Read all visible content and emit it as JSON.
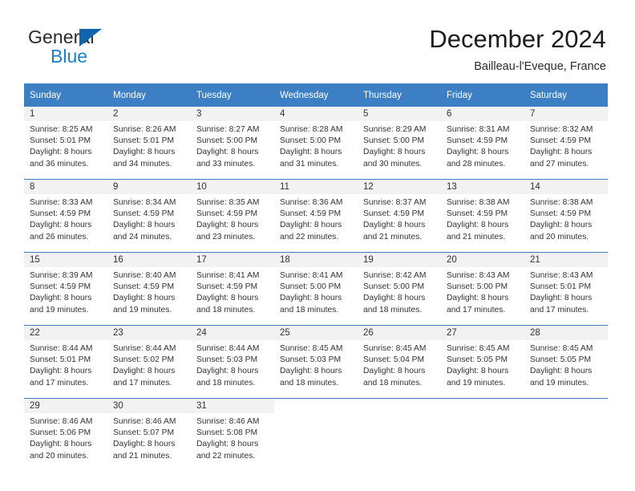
{
  "logo": {
    "word_top": "General",
    "word_bottom": "Blue",
    "triangle_color": "#1264ac",
    "blue_color": "#1b7fd4"
  },
  "header": {
    "title": "December 2024",
    "subtitle": "Bailleau-l'Eveque, France"
  },
  "colors": {
    "header_row": "#3c7fc4",
    "daynum_band": "#f2f2f2",
    "text": "#333333"
  },
  "weekday_headers": [
    "Sunday",
    "Monday",
    "Tuesday",
    "Wednesday",
    "Thursday",
    "Friday",
    "Saturday"
  ],
  "weeks": [
    [
      {
        "day": "1",
        "sunrise": "Sunrise: 8:25 AM",
        "sunset": "Sunset: 5:01 PM",
        "daylight1": "Daylight: 8 hours",
        "daylight2": "and 36 minutes."
      },
      {
        "day": "2",
        "sunrise": "Sunrise: 8:26 AM",
        "sunset": "Sunset: 5:01 PM",
        "daylight1": "Daylight: 8 hours",
        "daylight2": "and 34 minutes."
      },
      {
        "day": "3",
        "sunrise": "Sunrise: 8:27 AM",
        "sunset": "Sunset: 5:00 PM",
        "daylight1": "Daylight: 8 hours",
        "daylight2": "and 33 minutes."
      },
      {
        "day": "4",
        "sunrise": "Sunrise: 8:28 AM",
        "sunset": "Sunset: 5:00 PM",
        "daylight1": "Daylight: 8 hours",
        "daylight2": "and 31 minutes."
      },
      {
        "day": "5",
        "sunrise": "Sunrise: 8:29 AM",
        "sunset": "Sunset: 5:00 PM",
        "daylight1": "Daylight: 8 hours",
        "daylight2": "and 30 minutes."
      },
      {
        "day": "6",
        "sunrise": "Sunrise: 8:31 AM",
        "sunset": "Sunset: 4:59 PM",
        "daylight1": "Daylight: 8 hours",
        "daylight2": "and 28 minutes."
      },
      {
        "day": "7",
        "sunrise": "Sunrise: 8:32 AM",
        "sunset": "Sunset: 4:59 PM",
        "daylight1": "Daylight: 8 hours",
        "daylight2": "and 27 minutes."
      }
    ],
    [
      {
        "day": "8",
        "sunrise": "Sunrise: 8:33 AM",
        "sunset": "Sunset: 4:59 PM",
        "daylight1": "Daylight: 8 hours",
        "daylight2": "and 26 minutes."
      },
      {
        "day": "9",
        "sunrise": "Sunrise: 8:34 AM",
        "sunset": "Sunset: 4:59 PM",
        "daylight1": "Daylight: 8 hours",
        "daylight2": "and 24 minutes."
      },
      {
        "day": "10",
        "sunrise": "Sunrise: 8:35 AM",
        "sunset": "Sunset: 4:59 PM",
        "daylight1": "Daylight: 8 hours",
        "daylight2": "and 23 minutes."
      },
      {
        "day": "11",
        "sunrise": "Sunrise: 8:36 AM",
        "sunset": "Sunset: 4:59 PM",
        "daylight1": "Daylight: 8 hours",
        "daylight2": "and 22 minutes."
      },
      {
        "day": "12",
        "sunrise": "Sunrise: 8:37 AM",
        "sunset": "Sunset: 4:59 PM",
        "daylight1": "Daylight: 8 hours",
        "daylight2": "and 21 minutes."
      },
      {
        "day": "13",
        "sunrise": "Sunrise: 8:38 AM",
        "sunset": "Sunset: 4:59 PM",
        "daylight1": "Daylight: 8 hours",
        "daylight2": "and 21 minutes."
      },
      {
        "day": "14",
        "sunrise": "Sunrise: 8:38 AM",
        "sunset": "Sunset: 4:59 PM",
        "daylight1": "Daylight: 8 hours",
        "daylight2": "and 20 minutes."
      }
    ],
    [
      {
        "day": "15",
        "sunrise": "Sunrise: 8:39 AM",
        "sunset": "Sunset: 4:59 PM",
        "daylight1": "Daylight: 8 hours",
        "daylight2": "and 19 minutes."
      },
      {
        "day": "16",
        "sunrise": "Sunrise: 8:40 AM",
        "sunset": "Sunset: 4:59 PM",
        "daylight1": "Daylight: 8 hours",
        "daylight2": "and 19 minutes."
      },
      {
        "day": "17",
        "sunrise": "Sunrise: 8:41 AM",
        "sunset": "Sunset: 4:59 PM",
        "daylight1": "Daylight: 8 hours",
        "daylight2": "and 18 minutes."
      },
      {
        "day": "18",
        "sunrise": "Sunrise: 8:41 AM",
        "sunset": "Sunset: 5:00 PM",
        "daylight1": "Daylight: 8 hours",
        "daylight2": "and 18 minutes."
      },
      {
        "day": "19",
        "sunrise": "Sunrise: 8:42 AM",
        "sunset": "Sunset: 5:00 PM",
        "daylight1": "Daylight: 8 hours",
        "daylight2": "and 18 minutes."
      },
      {
        "day": "20",
        "sunrise": "Sunrise: 8:43 AM",
        "sunset": "Sunset: 5:00 PM",
        "daylight1": "Daylight: 8 hours",
        "daylight2": "and 17 minutes."
      },
      {
        "day": "21",
        "sunrise": "Sunrise: 8:43 AM",
        "sunset": "Sunset: 5:01 PM",
        "daylight1": "Daylight: 8 hours",
        "daylight2": "and 17 minutes."
      }
    ],
    [
      {
        "day": "22",
        "sunrise": "Sunrise: 8:44 AM",
        "sunset": "Sunset: 5:01 PM",
        "daylight1": "Daylight: 8 hours",
        "daylight2": "and 17 minutes."
      },
      {
        "day": "23",
        "sunrise": "Sunrise: 8:44 AM",
        "sunset": "Sunset: 5:02 PM",
        "daylight1": "Daylight: 8 hours",
        "daylight2": "and 17 minutes."
      },
      {
        "day": "24",
        "sunrise": "Sunrise: 8:44 AM",
        "sunset": "Sunset: 5:03 PM",
        "daylight1": "Daylight: 8 hours",
        "daylight2": "and 18 minutes."
      },
      {
        "day": "25",
        "sunrise": "Sunrise: 8:45 AM",
        "sunset": "Sunset: 5:03 PM",
        "daylight1": "Daylight: 8 hours",
        "daylight2": "and 18 minutes."
      },
      {
        "day": "26",
        "sunrise": "Sunrise: 8:45 AM",
        "sunset": "Sunset: 5:04 PM",
        "daylight1": "Daylight: 8 hours",
        "daylight2": "and 18 minutes."
      },
      {
        "day": "27",
        "sunrise": "Sunrise: 8:45 AM",
        "sunset": "Sunset: 5:05 PM",
        "daylight1": "Daylight: 8 hours",
        "daylight2": "and 19 minutes."
      },
      {
        "day": "28",
        "sunrise": "Sunrise: 8:45 AM",
        "sunset": "Sunset: 5:05 PM",
        "daylight1": "Daylight: 8 hours",
        "daylight2": "and 19 minutes."
      }
    ],
    [
      {
        "day": "29",
        "sunrise": "Sunrise: 8:46 AM",
        "sunset": "Sunset: 5:06 PM",
        "daylight1": "Daylight: 8 hours",
        "daylight2": "and 20 minutes."
      },
      {
        "day": "30",
        "sunrise": "Sunrise: 8:46 AM",
        "sunset": "Sunset: 5:07 PM",
        "daylight1": "Daylight: 8 hours",
        "daylight2": "and 21 minutes."
      },
      {
        "day": "31",
        "sunrise": "Sunrise: 8:46 AM",
        "sunset": "Sunset: 5:08 PM",
        "daylight1": "Daylight: 8 hours",
        "daylight2": "and 22 minutes."
      },
      {
        "day": "",
        "sunrise": "",
        "sunset": "",
        "daylight1": "",
        "daylight2": ""
      },
      {
        "day": "",
        "sunrise": "",
        "sunset": "",
        "daylight1": "",
        "daylight2": ""
      },
      {
        "day": "",
        "sunrise": "",
        "sunset": "",
        "daylight1": "",
        "daylight2": ""
      },
      {
        "day": "",
        "sunrise": "",
        "sunset": "",
        "daylight1": "",
        "daylight2": ""
      }
    ]
  ]
}
